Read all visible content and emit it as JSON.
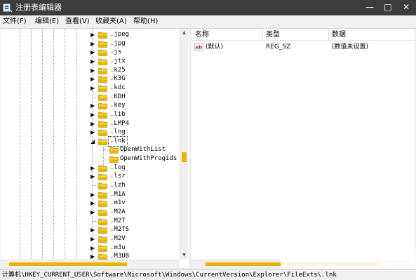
{
  "window": {
    "title": "注册表编辑器",
    "controls": {
      "minimize": "—",
      "maximize": "□",
      "close": "✕"
    }
  },
  "menu": [
    {
      "label": "文件(F)"
    },
    {
      "label": "编辑(E)"
    },
    {
      "label": "查看(V)"
    },
    {
      "label": "收藏夹(A)"
    },
    {
      "label": "帮助(H)"
    }
  ],
  "tree": {
    "items": [
      {
        "label": ".jpeg",
        "expand": "collapsed"
      },
      {
        "label": ".jpg",
        "expand": "collapsed"
      },
      {
        "label": ".js",
        "expand": "collapsed"
      },
      {
        "label": ".jtx",
        "expand": "collapsed"
      },
      {
        "label": ".k25",
        "expand": "collapsed"
      },
      {
        "label": ".K3G",
        "expand": "collapsed"
      },
      {
        "label": ".kdc",
        "expand": "collapsed"
      },
      {
        "label": ".KDH",
        "expand": "none"
      },
      {
        "label": ".key",
        "expand": "collapsed"
      },
      {
        "label": ".lib",
        "expand": "collapsed"
      },
      {
        "label": ".LMP4",
        "expand": "collapsed"
      },
      {
        "label": ".lng",
        "expand": "collapsed"
      },
      {
        "label": ".lnk",
        "expand": "expanded",
        "selected": true
      },
      {
        "label": "OpenWithList",
        "expand": "none",
        "child": true
      },
      {
        "label": "OpenWithProgids",
        "expand": "none",
        "child": true
      },
      {
        "label": ".log",
        "expand": "collapsed"
      },
      {
        "label": ".lsr",
        "expand": "collapsed"
      },
      {
        "label": ".lzh",
        "expand": "none"
      },
      {
        "label": ".M1A",
        "expand": "collapsed"
      },
      {
        "label": ".m1v",
        "expand": "collapsed"
      },
      {
        "label": ".M2A",
        "expand": "collapsed"
      },
      {
        "label": ".M2T",
        "expand": "none"
      },
      {
        "label": ".M2TS",
        "expand": "collapsed"
      },
      {
        "label": ".M2V",
        "expand": "collapsed"
      },
      {
        "label": ".m3u",
        "expand": "collapsed"
      },
      {
        "label": ".M3U8",
        "expand": "collapsed"
      }
    ]
  },
  "list": {
    "columns": {
      "name": "名称",
      "type": "类型",
      "data": "数据"
    },
    "rows": [
      {
        "icon": "ab-string-value-icon",
        "name": "(默认)",
        "type": "REG_SZ",
        "data": "(数值未设置)"
      }
    ]
  },
  "status": {
    "path": "计算机\\HKEY_CURRENT_USER\\Software\\Microsoft\\Windows\\CurrentVersion\\Explorer\\FileExts\\.lnk"
  },
  "colors": {
    "folder": "#e8b400",
    "titlebar": "#3c3c3c",
    "scroll_thumb": "#e8b400"
  }
}
